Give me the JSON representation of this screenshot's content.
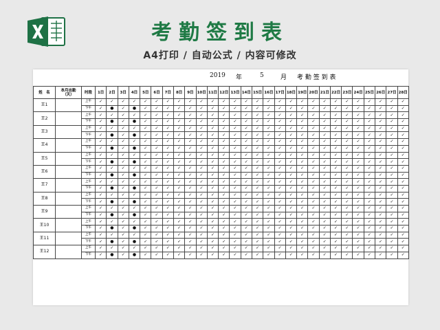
{
  "header": {
    "title": "考勤签到表",
    "subtitle": "A4打印 / 自动公式 / 内容可修改"
  },
  "sheet": {
    "year": "2019",
    "year_unit": "年",
    "month": "5",
    "month_unit": "月",
    "table_title": "考 勤 签 到 表",
    "col_name": "姓　名",
    "col_total_line1": "本月出勤",
    "col_total_line2": "（天）",
    "col_slot": "时段",
    "days": [
      "1日",
      "2日",
      "3日",
      "4日",
      "5日",
      "6日",
      "7日",
      "8日",
      "9日",
      "10日",
      "11日",
      "12日",
      "13日",
      "14日",
      "15日",
      "16日",
      "17日",
      "18日",
      "19日",
      "20日",
      "21日",
      "22日",
      "23日",
      "24日",
      "25日",
      "26日",
      "27日",
      "28日"
    ],
    "slots": [
      "上午",
      "下午"
    ],
    "check_mark": "✓",
    "leave_mark": "●",
    "employees": [
      {
        "name": "王1",
        "am_leave": [],
        "pm_leave": [
          2,
          4
        ]
      },
      {
        "name": "王2",
        "am_leave": [],
        "pm_leave": [
          2,
          4
        ]
      },
      {
        "name": "王3",
        "am_leave": [],
        "pm_leave": [
          2,
          4
        ]
      },
      {
        "name": "王4",
        "am_leave": [],
        "pm_leave": [
          2,
          4
        ]
      },
      {
        "name": "王5",
        "am_leave": [],
        "pm_leave": [
          2,
          4
        ]
      },
      {
        "name": "王6",
        "am_leave": [],
        "pm_leave": [
          2,
          4
        ]
      },
      {
        "name": "王7",
        "am_leave": [],
        "pm_leave": [
          2,
          4
        ]
      },
      {
        "name": "王8",
        "am_leave": [],
        "pm_leave": [
          2,
          4
        ]
      },
      {
        "name": "王9",
        "am_leave": [],
        "pm_leave": [
          2,
          4
        ]
      },
      {
        "name": "王10",
        "am_leave": [],
        "pm_leave": [
          2,
          4
        ]
      },
      {
        "name": "王11",
        "am_leave": [],
        "pm_leave": [
          2,
          4
        ]
      },
      {
        "name": "王12",
        "am_leave": [],
        "pm_leave": [
          2,
          4
        ]
      }
    ]
  },
  "colors": {
    "title_green": "#1f7a45",
    "excel_green": "#1e7145"
  },
  "icons": {
    "logo": "excel-logo-icon"
  }
}
